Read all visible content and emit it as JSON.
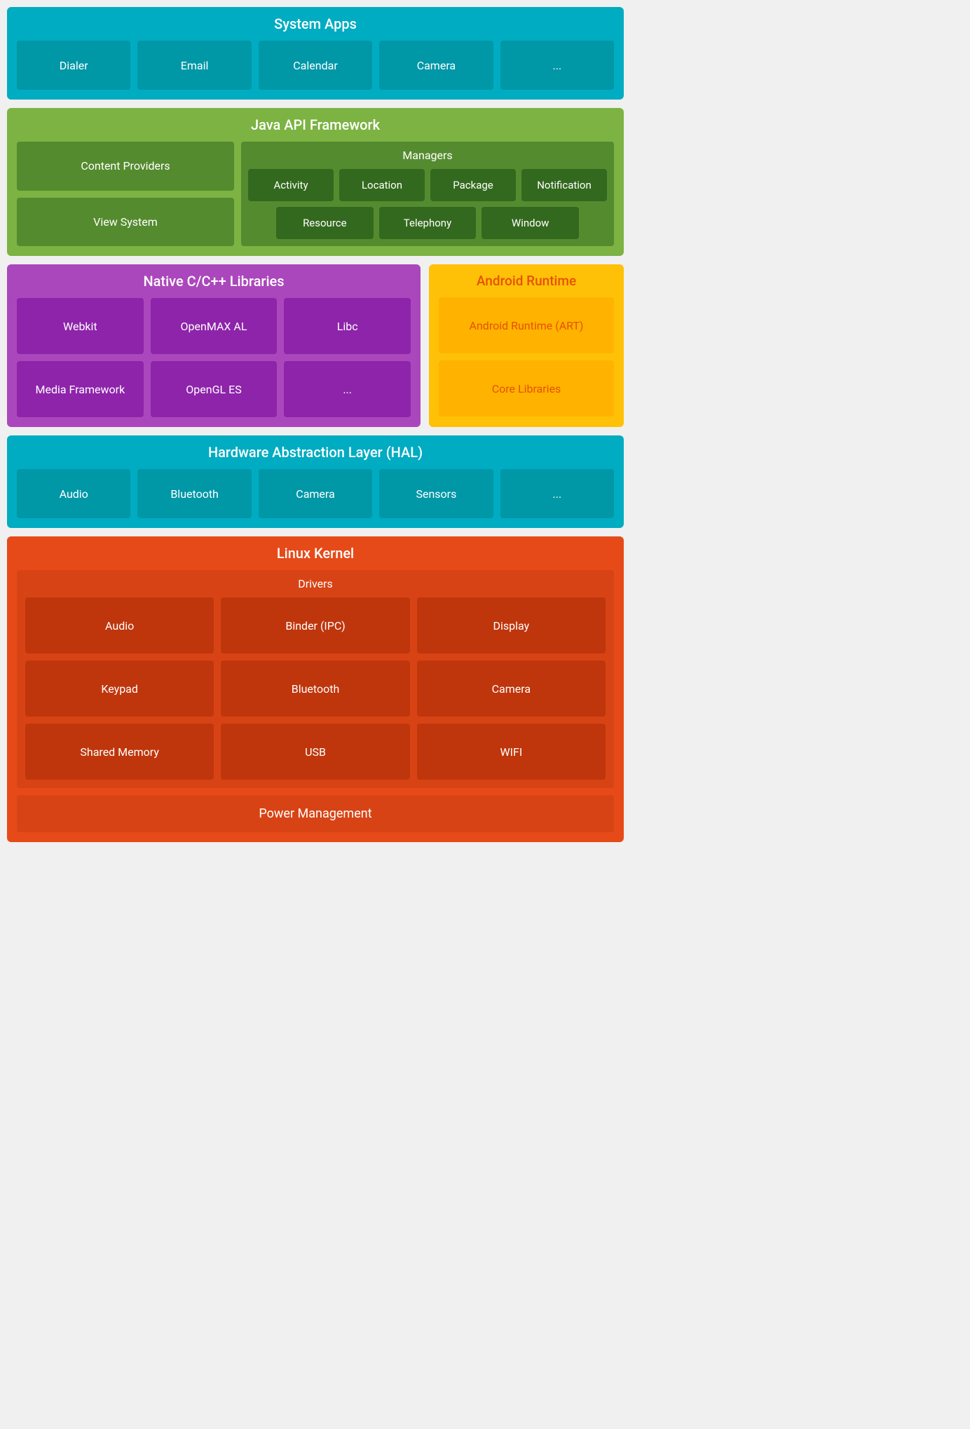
{
  "systemApps": {
    "title": "System Apps",
    "cards": [
      "Dialer",
      "Email",
      "Calendar",
      "Camera",
      "..."
    ]
  },
  "javaApi": {
    "title": "Java API Framework",
    "contentProviders": "Content Providers",
    "viewSystem": "View System",
    "managers": {
      "title": "Managers",
      "row1": [
        "Activity",
        "Location",
        "Package",
        "Notification"
      ],
      "row2": [
        "Resource",
        "Telephony",
        "Window"
      ]
    }
  },
  "nativeLibs": {
    "title": "Native C/C++ Libraries",
    "cards": [
      "Webkit",
      "OpenMAX AL",
      "Libc",
      "Media Framework",
      "OpenGL ES",
      "..."
    ]
  },
  "androidRuntime": {
    "title": "Android Runtime",
    "cards": [
      "Android Runtime (ART)",
      "Core Libraries"
    ]
  },
  "hal": {
    "title": "Hardware Abstraction Layer (HAL)",
    "cards": [
      "Audio",
      "Bluetooth",
      "Camera",
      "Sensors",
      "..."
    ]
  },
  "linuxKernel": {
    "title": "Linux Kernel",
    "drivers": {
      "title": "Drivers",
      "cards": [
        "Audio",
        "Binder (IPC)",
        "Display",
        "Keypad",
        "Bluetooth",
        "Camera",
        "Shared Memory",
        "USB",
        "WIFI"
      ]
    },
    "powerManagement": "Power Management"
  }
}
